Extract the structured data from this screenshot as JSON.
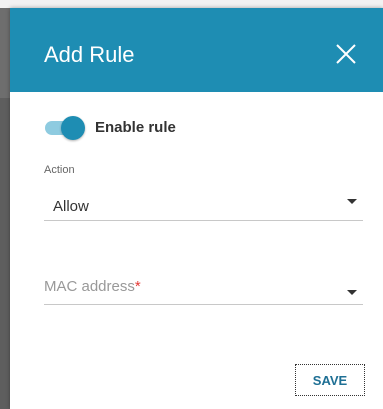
{
  "dialog": {
    "title": "Add Rule",
    "close_icon": "close-icon",
    "header_color": "#1e8db3"
  },
  "enable_rule": {
    "label": "Enable rule",
    "checked": true
  },
  "action": {
    "label": "Action",
    "value": "Allow",
    "icon": "chevron-down-icon"
  },
  "mac_address": {
    "placeholder": "MAC address",
    "required_mark": "*",
    "icon": "chevron-down-icon"
  },
  "footer": {
    "save_label": "SAVE"
  }
}
